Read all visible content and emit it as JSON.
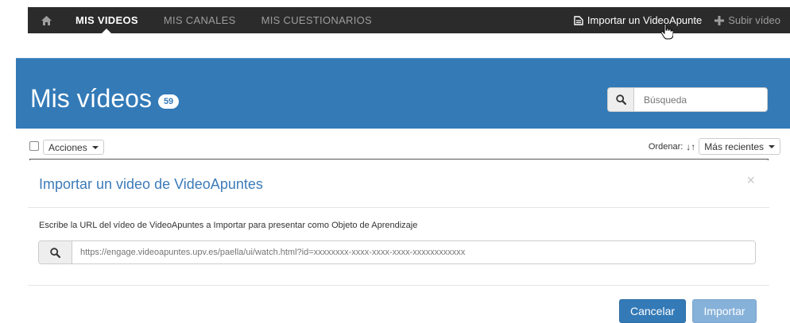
{
  "navbar": {
    "home_icon": "home-icon",
    "items": [
      {
        "label": "MIS VIDEOS",
        "active": true
      },
      {
        "label": "MIS CANALES",
        "active": false
      },
      {
        "label": "MIS CUESTIONARIOS",
        "active": false
      }
    ],
    "import_label": "Importar un VideoApunte",
    "upload_label": "Subir vídeo"
  },
  "header": {
    "title": "Mis vídeos",
    "count": "59",
    "search_placeholder": "Búsqueda"
  },
  "toolbar": {
    "actions_label": "Acciones",
    "order_label": "Ordenar:",
    "order_value": "Más recientes"
  },
  "modal": {
    "title": "Importar un video de VideoApuntes",
    "close_glyph": "×",
    "description": "Escribe la URL del vídeo de VideoApuntes a Importar para presentar como Objeto de Aprendizaje",
    "url_placeholder": "https://engage.videoapuntes.upv.es/paella/ui/watch.html?id=xxxxxxxx-xxxx-xxxx-xxxx-xxxxxxxxxxxx",
    "cancel_label": "Cancelar",
    "import_label": "Importar"
  },
  "colors": {
    "navbar_bg": "#2b2b2b",
    "header_blue": "#337ab7",
    "primary_button": "#337ab7",
    "disabled_button": "#86b1d9",
    "modal_title": "#3c7bb8"
  }
}
